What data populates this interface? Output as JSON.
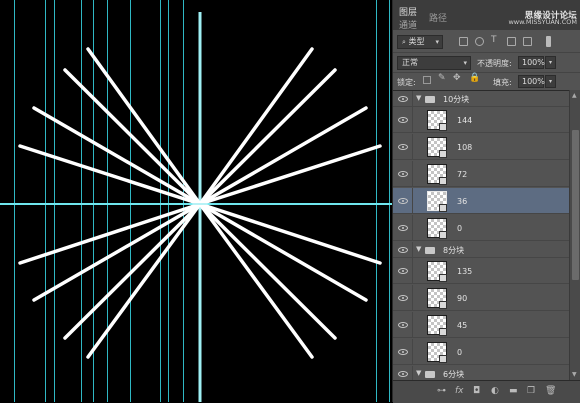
{
  "panel": {
    "tabs": {
      "layers": "图层",
      "channels": "通道",
      "paths": "路径"
    },
    "watermark": {
      "title": "思缘设计论坛",
      "site": "www.MISSYUAN.COM"
    },
    "filter": {
      "kind_label": "类型"
    },
    "blend": {
      "mode": "正常",
      "opacity_label": "不透明度:",
      "opacity_value": "100%"
    },
    "lock": {
      "label": "锁定:",
      "fill_label": "填充:",
      "fill_value": "100%"
    }
  },
  "layers": [
    {
      "type": "group",
      "name": "10分块",
      "expanded": true
    },
    {
      "type": "layer",
      "name": "144"
    },
    {
      "type": "layer",
      "name": "108"
    },
    {
      "type": "layer",
      "name": "72"
    },
    {
      "type": "layer",
      "name": "36",
      "selected": true
    },
    {
      "type": "layer",
      "name": "0"
    },
    {
      "type": "group",
      "name": "8分块",
      "expanded": true
    },
    {
      "type": "layer",
      "name": "135"
    },
    {
      "type": "layer",
      "name": "90"
    },
    {
      "type": "layer",
      "name": "45"
    },
    {
      "type": "layer",
      "name": "0"
    },
    {
      "type": "group",
      "name": "6分块",
      "expanded": true
    }
  ],
  "canvas": {
    "background": "#000000",
    "stroke_color": "#ffffff",
    "guide_color": "#4fd0d8"
  },
  "footer_icons": [
    "link-icon",
    "fx-icon",
    "mask-icon",
    "adjustment-icon",
    "folder-icon",
    "new-layer-icon",
    "trash-icon"
  ]
}
